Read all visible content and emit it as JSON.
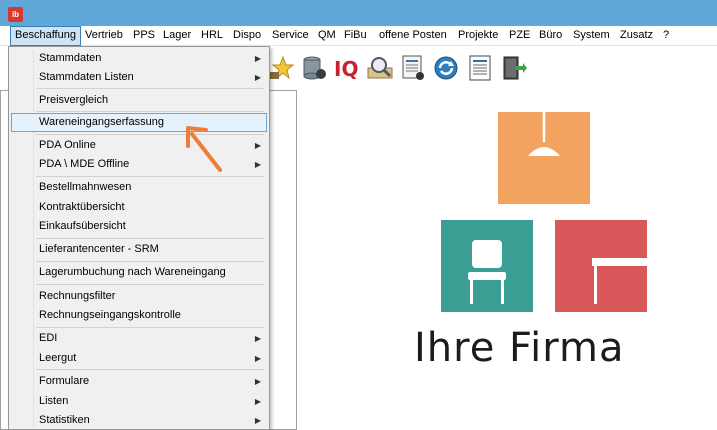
{
  "titlebar": {
    "icon_text": "ib"
  },
  "menubar": {
    "items": [
      {
        "label": "Beschaffung"
      },
      {
        "label": "Vertrieb"
      },
      {
        "label": "PPS"
      },
      {
        "label": "Lager"
      },
      {
        "label": "HRL"
      },
      {
        "label": "Dispo"
      },
      {
        "label": "Service"
      },
      {
        "label": "QM"
      },
      {
        "label": "FiBu"
      },
      {
        "label": "offene Posten"
      },
      {
        "label": "Projekte"
      },
      {
        "label": "PZE"
      },
      {
        "label": "Büro"
      },
      {
        "label": "System"
      },
      {
        "label": "Zusatz"
      },
      {
        "label": "?"
      }
    ]
  },
  "dropdown": {
    "items": [
      {
        "label": "Stammdaten",
        "submenu": true
      },
      {
        "label": "Stammdaten Listen",
        "submenu": true
      },
      {
        "label": "Preisvergleich",
        "submenu": false
      },
      {
        "label": "Wareneingangserfassung",
        "submenu": false
      },
      {
        "label": "PDA Online",
        "submenu": true
      },
      {
        "label": "PDA \\ MDE Offline",
        "submenu": true
      },
      {
        "label": "Bestellmahnwesen",
        "submenu": false
      },
      {
        "label": "Kontraktübersicht",
        "submenu": false
      },
      {
        "label": "Einkaufsübersicht",
        "submenu": false
      },
      {
        "label": "Lieferantencenter - SRM",
        "submenu": false
      },
      {
        "label": "Lagerumbuchung nach Wareneingang",
        "submenu": false
      },
      {
        "label": "Rechnungsfilter",
        "submenu": false
      },
      {
        "label": "Rechnungseingangskontrolle",
        "submenu": false
      },
      {
        "label": "EDI",
        "submenu": true
      },
      {
        "label": "Leergut",
        "submenu": true
      },
      {
        "label": "Formulare",
        "submenu": true
      },
      {
        "label": "Listen",
        "submenu": true
      },
      {
        "label": "Statistiken",
        "submenu": true
      }
    ],
    "submenu_arrow": "▶"
  },
  "toolbar": {
    "icons": [
      "star-icon",
      "database-icon",
      "iq-icon",
      "magnifier-icon",
      "report-icon",
      "refresh-icon",
      "document-list-icon",
      "exit-door-icon"
    ],
    "iq_text": "IQ"
  },
  "logo": {
    "text": "Ihre Firma",
    "colors": {
      "lamp": "#f2a35f",
      "chair": "#3a9e94",
      "table": "#d95758",
      "text": "#1c1c1c"
    }
  },
  "annotation": {
    "arrow_color": "#ee7d3b"
  }
}
